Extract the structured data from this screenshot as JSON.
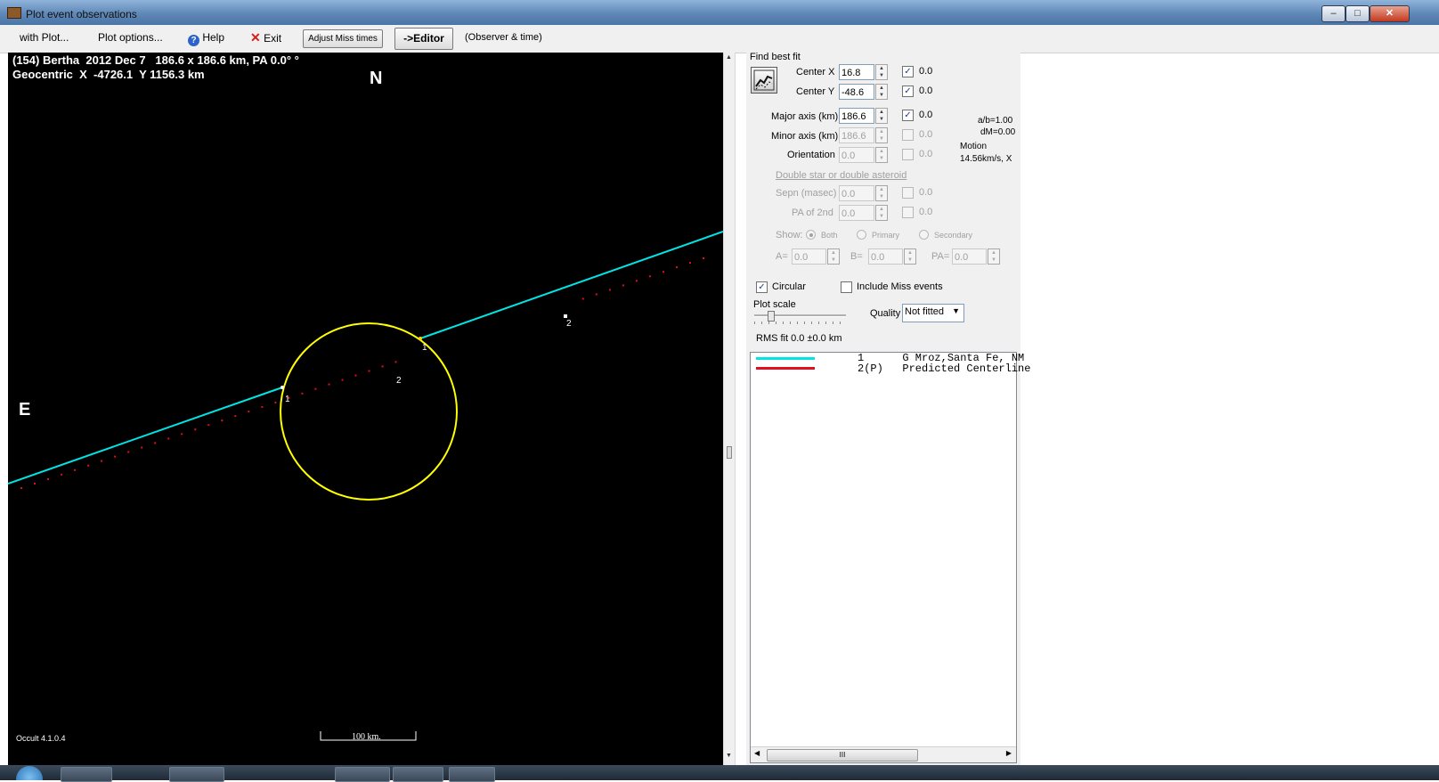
{
  "window": {
    "title": "Plot event observations",
    "minimize_label": "–",
    "maximize_label": "□",
    "close_label": "✕"
  },
  "menu": {
    "with_plot": "with Plot...",
    "plot_options": "Plot options...",
    "help": "Help",
    "exit": "Exit",
    "adjust_miss_times": "Adjust Miss times",
    "editor": "->Editor",
    "observer_time": "(Observer & time)"
  },
  "icons": {
    "help": "help-icon",
    "exit": "red-x-icon",
    "fit": "best-fit-chart-icon"
  },
  "plot": {
    "header_line1": "(154) Bertha  2012 Dec 7   186.6 x 186.6 km, PA 0.0° °",
    "header_line2": "Geocentric  X  -4726.1  Y 1156.3 km",
    "north_label": "N",
    "east_label": "E",
    "scale_label": "100 km.",
    "version_label": "Occult 4.1.0.4",
    "chord_labels": {
      "obs_1_d": "1",
      "obs_1_r": "1",
      "pred_2_d": "2",
      "pred_2_r": "2"
    },
    "colors": {
      "observer_chord": "#00e5e5",
      "predicted_chord": "#e01020",
      "profile": "#ffff00",
      "background": "#000000"
    }
  },
  "fit_panel": {
    "find_best_fit_label": "Find best fit",
    "center_x": {
      "label": "Center X",
      "value": "16.8",
      "check_label": "0.0",
      "checked": true
    },
    "center_y": {
      "label": "Center Y",
      "value": "-48.6",
      "check_label": "0.0",
      "checked": true
    },
    "major_axis": {
      "label": "Major axis (km)",
      "value": "186.6",
      "check_label": "0.0",
      "checked": true
    },
    "minor_axis": {
      "label": "Minor axis (km)",
      "value": "186.6",
      "check_label": "0.0",
      "checked": false
    },
    "orientation": {
      "label": "Orientation",
      "value": "0.0",
      "check_label": "0.0",
      "checked": false
    },
    "ab_ratio": "a/b=1.00",
    "dm": "dM=0.00",
    "motion_label": "Motion",
    "motion_value": "14.56km/s, X",
    "double_star_label": "Double star  or  double asteroid",
    "sepn": {
      "label": "Sepn (masec)",
      "value": "0.0",
      "check_label": "0.0"
    },
    "pa_2nd": {
      "label": "PA of 2nd",
      "value": "0.0",
      "check_label": "0.0"
    },
    "show_label": "Show:",
    "show_options": [
      "Both",
      "Primary",
      "Secondary"
    ],
    "show_selected": "Both",
    "a_label": "A=",
    "a_value": "0.0",
    "b_label": "B=",
    "b_value": "0.0",
    "pa_label": "PA=",
    "pa_value": "0.0",
    "circular_label": "Circular",
    "circular_checked": true,
    "include_miss_label": "Include Miss events",
    "include_miss_checked": false,
    "plot_scale_label": "Plot scale",
    "plot_scale_level": 0.15,
    "quality_label": "Quality",
    "quality_value": "Not fitted",
    "rms_fit": "RMS fit 0.0 ±0.0 km"
  },
  "legend": {
    "entries": [
      {
        "text": "1      G Mroz,Santa Fe, NM",
        "color": "#00e5e5"
      },
      {
        "text": "2(P)   Predicted Centerline",
        "color": "#e01020"
      }
    ],
    "scroll_thumb_label": "III"
  }
}
